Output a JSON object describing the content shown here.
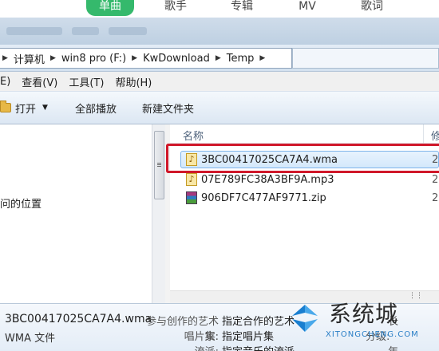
{
  "app_tabs": [
    {
      "label": "单曲",
      "active": true
    },
    {
      "label": "歌手",
      "active": false
    },
    {
      "label": "专辑",
      "active": false
    },
    {
      "label": "MV",
      "active": false
    },
    {
      "label": "歌词",
      "active": false
    }
  ],
  "address": {
    "crumbs": [
      "计算机",
      "win8 pro (F:)",
      "KwDownload",
      "Temp"
    ]
  },
  "menu": [
    "E)",
    "查看(V)",
    "工具(T)",
    "帮助(H)"
  ],
  "commands": {
    "open": "打开",
    "play_all": "全部播放",
    "new_folder": "新建文件夹"
  },
  "nav": {
    "item": "问的位置"
  },
  "list": {
    "col_name": "名称",
    "col_date": "修",
    "files": [
      {
        "name": "3BC00417025CA7A4.wma",
        "date": "2",
        "icon": "music-file-icon",
        "selected": true
      },
      {
        "name": "07E789FC38A3BF9A.mp3",
        "date": "2",
        "icon": "music-file-icon",
        "selected": false
      },
      {
        "name": "906DF7C477AF9771.zip",
        "date": "2",
        "icon": "zip-archive-icon",
        "selected": false
      }
    ]
  },
  "details": {
    "file_name": "3BC00417025CA7A4.wma",
    "file_type": "WMA 文件",
    "fields": [
      {
        "key": "参与创作的艺术家:",
        "value": "指定合作的艺术"
      },
      {
        "key": "唱片集:",
        "value": "指定唱片集"
      },
      {
        "key": "流派:",
        "value": "指定音乐的流派"
      }
    ],
    "right_labels": [
      "长",
      "分级:",
      "年"
    ]
  },
  "watermark": {
    "text": "系统城",
    "url": "XITONGCHENG.COM"
  },
  "colors": {
    "app_accent": "#35b96c",
    "highlight": "#d0182a",
    "selection_border": "#7eb4ea"
  }
}
